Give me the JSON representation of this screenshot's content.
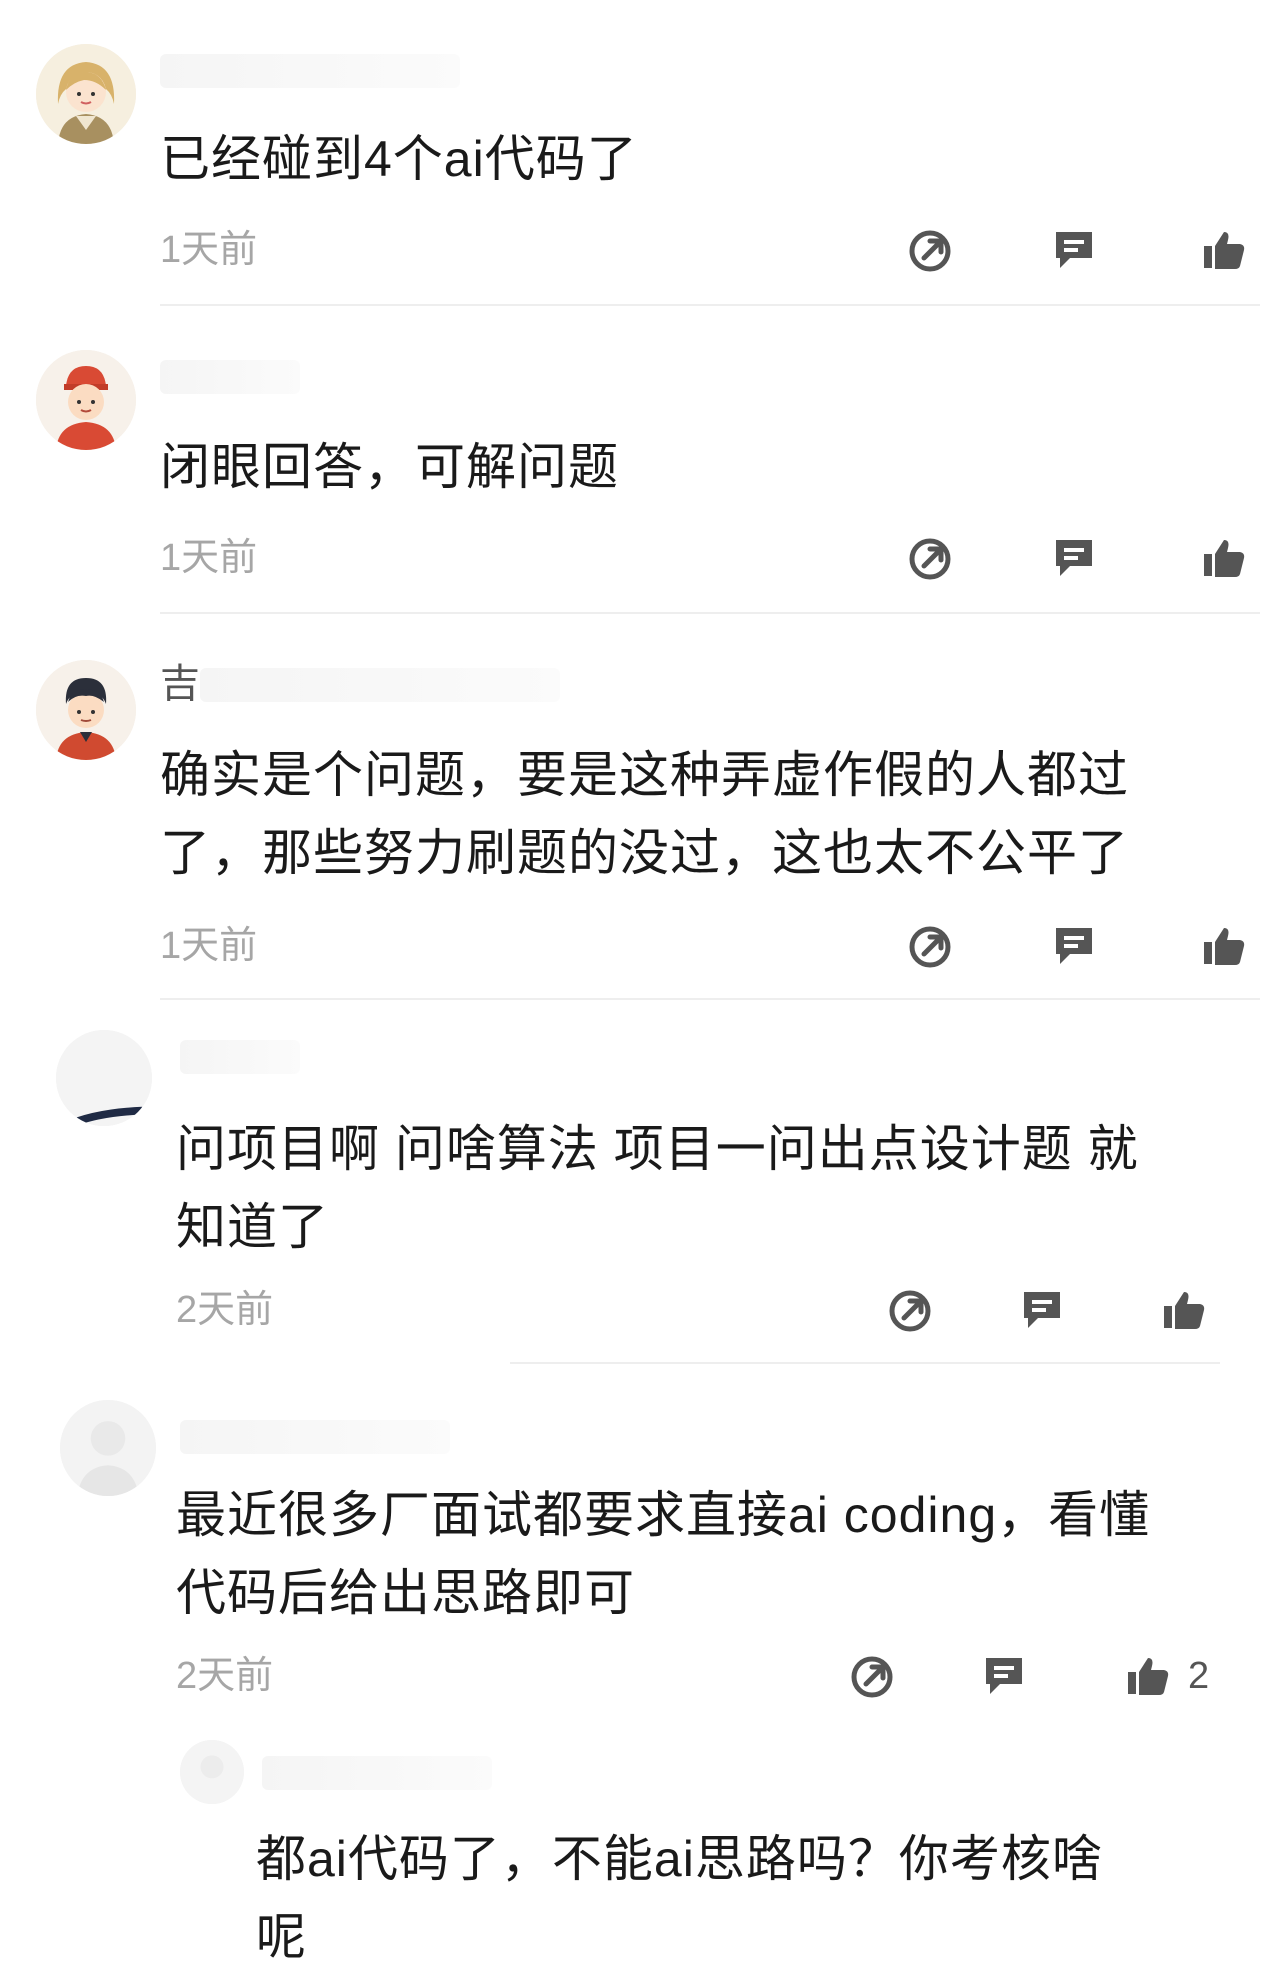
{
  "comments": [
    {
      "text": "已经碰到4个ai代码了",
      "time": "1天前"
    },
    {
      "text": "闭眼回答，可解问题",
      "time": "1天前"
    },
    {
      "username_char": "吉",
      "text": "确实是个问题，要是这种弄虚作假的人都过\n了，那些努力刷题的没过，这也太不公平了",
      "time": "1天前"
    },
    {
      "text": "问项目啊 问啥算法 项目一问出点设计题 就\n知道了",
      "time": "2天前"
    },
    {
      "text": "最近很多厂面试都要求直接ai coding，看懂\n代码后给出思路即可",
      "time": "2天前",
      "likes": "2"
    },
    {
      "text": "都ai代码了，不能ai思路吗？你考核啥\n呢",
      "time": ""
    }
  ],
  "icons": {
    "share": "share-icon",
    "reply": "reply-icon",
    "like": "thumbs-up-icon"
  },
  "colors": {
    "icon": "#555555",
    "time": "#a6a6a6",
    "text": "#1a1a1a"
  }
}
